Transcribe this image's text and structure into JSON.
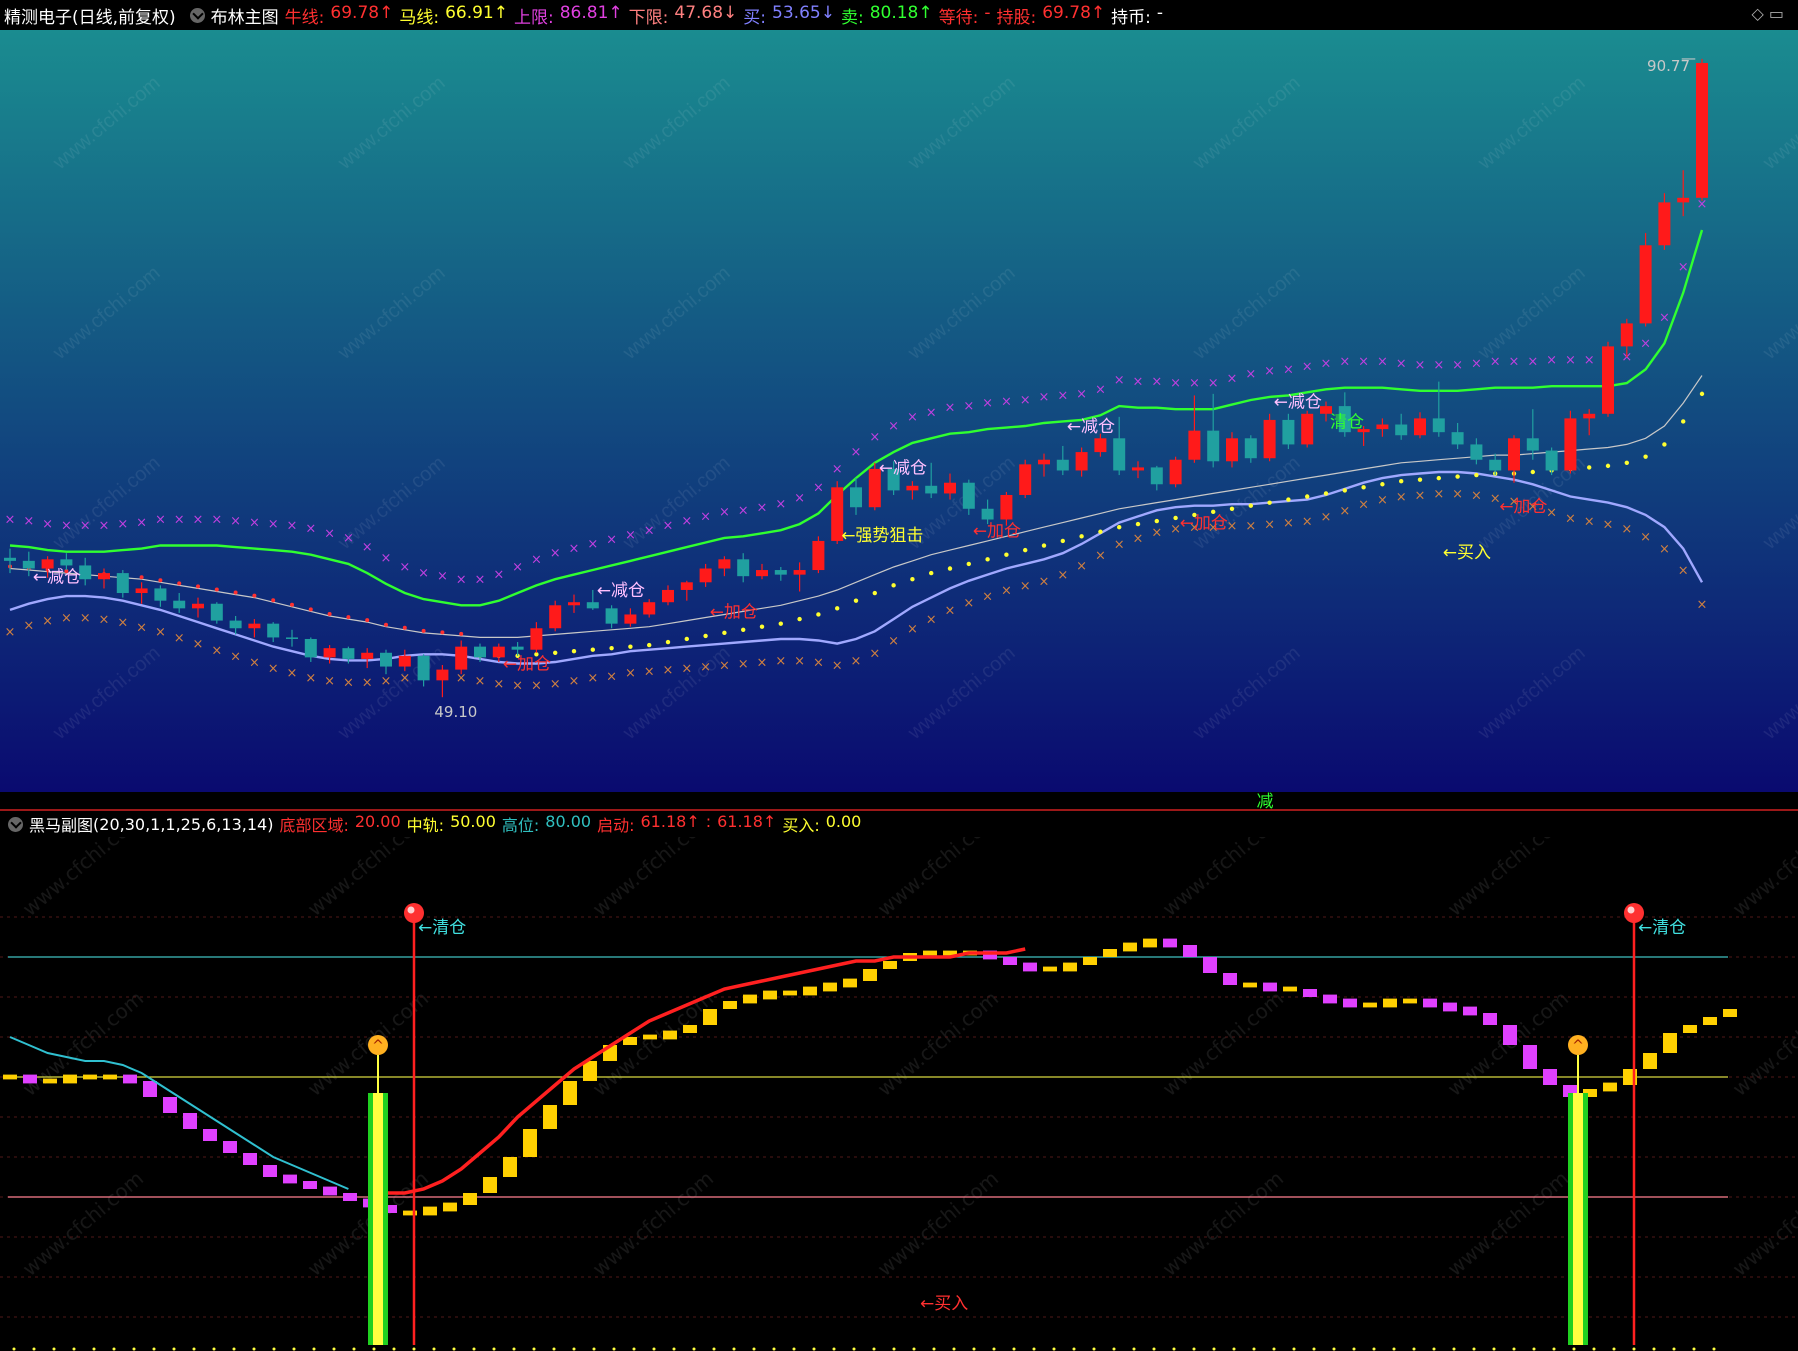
{
  "top_header": {
    "stock_name": "精测电子",
    "period": "(日线,前复权)",
    "indicator_name": "布林主图",
    "items": [
      {
        "label": "牛线:",
        "value": "69.78",
        "arrow": "↑",
        "color": "#ff3030"
      },
      {
        "label": "马线:",
        "value": "66.91",
        "arrow": "↑",
        "color": "#ffff30"
      },
      {
        "label": "上限:",
        "value": "86.81",
        "arrow": "↑",
        "color": "#e040e0"
      },
      {
        "label": "下限:",
        "value": "47.68",
        "arrow": "↓",
        "color": "#ff8080"
      },
      {
        "label": "买:",
        "value": "53.65",
        "arrow": "↓",
        "color": "#8080ff"
      },
      {
        "label": "卖:",
        "value": "80.18",
        "arrow": "↑",
        "color": "#30ff30"
      },
      {
        "label": "等待:",
        "value": "-",
        "arrow": "",
        "color": "#ff3030"
      },
      {
        "label": "持股:",
        "value": "69.78",
        "arrow": "↑",
        "color": "#ff3030"
      },
      {
        "label": "持币:",
        "value": "-",
        "arrow": "",
        "color": "#ffffff"
      }
    ],
    "right_icons": "◇ ▭"
  },
  "sub_header": {
    "indicator_name": "黑马副图",
    "params": "(20,30,1,1,25,6,13,14)",
    "items": [
      {
        "label": "底部区域:",
        "value": "20.00",
        "color": "#ff3030"
      },
      {
        "label": "中轨:",
        "value": "50.00",
        "color": "#ffff30"
      },
      {
        "label": "高位:",
        "value": "80.00",
        "color": "#30c0c0"
      },
      {
        "label": "启动:",
        "value": "61.18",
        "arrow": "↑",
        "color": "#ff3030"
      },
      {
        "label": ":",
        "value": "61.18",
        "arrow": "↑",
        "color": "#ff3030"
      },
      {
        "label": "买入:",
        "value": "0.00",
        "color": "#ffff30"
      }
    ]
  },
  "main_annotations": {
    "high_label": "90.77",
    "low_label": "49.10",
    "divider_mark": "减",
    "signals": [
      {
        "text": "←减仓",
        "color": "#ffc0ff"
      },
      {
        "text": "←加仓",
        "color": "#ff3030"
      },
      {
        "text": "←减仓",
        "color": "#ffc0ff"
      },
      {
        "text": "←加仓",
        "color": "#ff3030"
      },
      {
        "text": "←强势狙击",
        "color": "#ffff30"
      },
      {
        "text": "←减仓",
        "color": "#ffc0ff"
      },
      {
        "text": "←加仓",
        "color": "#ff3030"
      },
      {
        "text": "←减仓",
        "color": "#ffc0ff"
      },
      {
        "text": "←加仓",
        "color": "#ff3030"
      },
      {
        "text": "←减仓",
        "color": "#ffc0ff"
      },
      {
        "text": "清仓",
        "color": "#30ff30"
      },
      {
        "text": "←买入",
        "color": "#ffff30"
      },
      {
        "text": "←加仓",
        "color": "#ff3030"
      }
    ]
  },
  "sub_annotations": {
    "signals": [
      {
        "text": "←清仓",
        "color": "#40e0e0"
      },
      {
        "text": "←清仓",
        "color": "#40e0e0"
      },
      {
        "text": "←买入",
        "color": "#ff3030"
      }
    ]
  },
  "watermark": "www.cfchi.com",
  "chart_data": [
    {
      "type": "candlestick",
      "title": "布林主图",
      "ylim": [
        45,
        92
      ],
      "max_label": 90.77,
      "min_label": 49.1,
      "candles": [
        [
          58.2,
          58.8,
          57.2,
          58.0
        ],
        [
          58.0,
          58.6,
          57.0,
          57.5
        ],
        [
          57.5,
          58.3,
          56.9,
          58.1
        ],
        [
          58.1,
          58.5,
          57.4,
          57.7
        ],
        [
          57.7,
          58.2,
          56.4,
          56.8
        ],
        [
          56.8,
          57.5,
          56.2,
          57.2
        ],
        [
          57.2,
          57.4,
          55.6,
          55.9
        ],
        [
          55.9,
          56.6,
          55.2,
          56.2
        ],
        [
          56.2,
          56.4,
          55.0,
          55.4
        ],
        [
          55.4,
          55.9,
          54.6,
          54.9
        ],
        [
          54.9,
          55.6,
          54.3,
          55.2
        ],
        [
          55.2,
          55.3,
          53.9,
          54.1
        ],
        [
          54.1,
          54.4,
          53.2,
          53.6
        ],
        [
          53.6,
          54.2,
          53.0,
          53.9
        ],
        [
          53.9,
          54.0,
          52.7,
          53.0
        ],
        [
          53.0,
          53.5,
          52.4,
          52.9
        ],
        [
          52.9,
          53.0,
          51.4,
          51.7
        ],
        [
          51.7,
          52.5,
          51.3,
          52.3
        ],
        [
          52.3,
          52.4,
          51.3,
          51.6
        ],
        [
          51.6,
          52.3,
          51.0,
          52.0
        ],
        [
          52.0,
          52.2,
          50.6,
          51.1
        ],
        [
          51.1,
          52.2,
          50.8,
          51.8
        ],
        [
          51.8,
          51.9,
          49.8,
          50.2
        ],
        [
          50.2,
          51.2,
          49.1,
          50.9
        ],
        [
          50.9,
          52.8,
          50.6,
          52.4
        ],
        [
          52.4,
          52.6,
          51.4,
          51.7
        ],
        [
          51.7,
          52.6,
          51.4,
          52.4
        ],
        [
          52.4,
          52.7,
          51.8,
          52.2
        ],
        [
          52.2,
          54.0,
          52.0,
          53.6
        ],
        [
          53.6,
          55.4,
          53.4,
          55.1
        ],
        [
          55.1,
          55.8,
          54.6,
          55.3
        ],
        [
          55.3,
          56.1,
          54.8,
          54.9
        ],
        [
          54.9,
          55.1,
          53.6,
          53.9
        ],
        [
          53.9,
          54.9,
          53.7,
          54.5
        ],
        [
          54.5,
          55.5,
          54.3,
          55.3
        ],
        [
          55.3,
          56.4,
          55.1,
          56.1
        ],
        [
          56.1,
          56.7,
          55.4,
          56.6
        ],
        [
          56.6,
          57.8,
          56.3,
          57.5
        ],
        [
          57.5,
          58.3,
          57.0,
          58.1
        ],
        [
          58.1,
          58.5,
          56.6,
          57.0
        ],
        [
          57.0,
          57.8,
          56.8,
          57.4
        ],
        [
          57.4,
          57.6,
          56.7,
          57.1
        ],
        [
          57.1,
          57.9,
          56.0,
          57.4
        ],
        [
          57.4,
          59.6,
          57.2,
          59.3
        ],
        [
          59.3,
          63.2,
          59.1,
          62.8
        ],
        [
          62.8,
          63.4,
          61.0,
          61.5
        ],
        [
          61.5,
          64.4,
          61.3,
          64.0
        ],
        [
          64.0,
          64.5,
          62.3,
          62.6
        ],
        [
          62.6,
          63.2,
          62.0,
          62.9
        ],
        [
          62.9,
          64.4,
          62.1,
          62.4
        ],
        [
          62.4,
          63.7,
          62.0,
          63.1
        ],
        [
          63.1,
          63.3,
          61.0,
          61.4
        ],
        [
          61.4,
          62.0,
          60.4,
          60.7
        ],
        [
          60.7,
          62.5,
          60.3,
          62.3
        ],
        [
          62.3,
          64.6,
          62.1,
          64.3
        ],
        [
          64.3,
          65.0,
          63.5,
          64.6
        ],
        [
          64.6,
          65.5,
          63.6,
          63.9
        ],
        [
          63.9,
          65.4,
          63.5,
          65.1
        ],
        [
          65.1,
          66.3,
          64.8,
          66.0
        ],
        [
          66.0,
          67.4,
          63.6,
          63.9
        ],
        [
          63.9,
          64.5,
          63.4,
          64.1
        ],
        [
          64.1,
          64.2,
          62.6,
          63.0
        ],
        [
          63.0,
          64.8,
          62.8,
          64.6
        ],
        [
          64.6,
          68.8,
          64.4,
          66.5
        ],
        [
          66.5,
          68.9,
          64.1,
          64.5
        ],
        [
          64.5,
          66.4,
          64.1,
          66.0
        ],
        [
          66.0,
          66.2,
          64.4,
          64.7
        ],
        [
          64.7,
          67.6,
          64.5,
          67.2
        ],
        [
          67.2,
          67.6,
          65.3,
          65.6
        ],
        [
          65.6,
          67.8,
          65.4,
          67.6
        ],
        [
          67.6,
          68.4,
          67.1,
          68.1
        ],
        [
          68.1,
          69.0,
          66.1,
          66.4
        ],
        [
          66.4,
          66.8,
          65.5,
          66.6
        ],
        [
          66.6,
          67.3,
          66.1,
          66.9
        ],
        [
          66.9,
          67.6,
          65.9,
          66.2
        ],
        [
          66.2,
          67.7,
          66.0,
          67.3
        ],
        [
          67.3,
          69.7,
          66.1,
          66.4
        ],
        [
          66.4,
          67.0,
          65.3,
          65.6
        ],
        [
          65.6,
          66.0,
          64.3,
          64.6
        ],
        [
          64.6,
          65.0,
          63.6,
          63.9
        ],
        [
          63.9,
          66.2,
          63.1,
          66.0
        ],
        [
          66.0,
          67.9,
          64.6,
          65.2
        ],
        [
          65.2,
          65.4,
          63.6,
          63.9
        ],
        [
          63.9,
          67.8,
          63.7,
          67.3
        ],
        [
          67.3,
          67.9,
          66.2,
          67.6
        ],
        [
          67.6,
          72.3,
          67.4,
          72.0
        ],
        [
          72.0,
          73.8,
          71.3,
          73.5
        ],
        [
          73.5,
          79.4,
          73.3,
          78.6
        ],
        [
          78.6,
          82.0,
          78.3,
          81.4
        ],
        [
          81.4,
          83.5,
          80.5,
          81.7
        ],
        [
          81.7,
          90.77,
          81.5,
          90.5
        ]
      ],
      "series": [
        {
          "name": "上限",
          "color": "#30ff30",
          "values": [
            59.0,
            58.9,
            58.7,
            58.6,
            58.6,
            58.6,
            58.7,
            58.8,
            59.0,
            59.0,
            59.0,
            59.0,
            58.9,
            58.8,
            58.7,
            58.6,
            58.4,
            58.1,
            57.8,
            57.2,
            56.5,
            55.9,
            55.5,
            55.3,
            55.1,
            55.1,
            55.4,
            55.9,
            56.4,
            56.8,
            57.1,
            57.4,
            57.7,
            58.0,
            58.3,
            58.6,
            58.9,
            59.2,
            59.5,
            59.6,
            59.8,
            60.0,
            60.4,
            61.1,
            62.3,
            63.4,
            64.4,
            65.1,
            65.7,
            66.0,
            66.3,
            66.4,
            66.6,
            66.7,
            66.8,
            67.0,
            67.1,
            67.2,
            67.5,
            68.1,
            68.0,
            68.0,
            67.9,
            67.9,
            67.9,
            68.2,
            68.5,
            68.7,
            68.8,
            69.0,
            69.2,
            69.3,
            69.3,
            69.3,
            69.2,
            69.1,
            69.1,
            69.1,
            69.2,
            69.3,
            69.3,
            69.3,
            69.4,
            69.4,
            69.4,
            69.4,
            69.6,
            70.5,
            72.2,
            75.5,
            79.6
          ]
        },
        {
          "name": "中轨",
          "color": "#c8c8c8",
          "values": [
            57.5,
            57.4,
            57.3,
            57.2,
            57.1,
            57.0,
            56.9,
            56.8,
            56.6,
            56.4,
            56.2,
            56.0,
            55.8,
            55.6,
            55.3,
            55.0,
            54.7,
            54.4,
            54.2,
            54.0,
            53.7,
            53.5,
            53.3,
            53.2,
            53.1,
            53.0,
            53.0,
            53.0,
            53.1,
            53.2,
            53.3,
            53.4,
            53.5,
            53.6,
            53.7,
            53.9,
            54.1,
            54.3,
            54.5,
            54.7,
            54.9,
            55.1,
            55.4,
            55.7,
            56.1,
            56.6,
            57.1,
            57.6,
            58.0,
            58.4,
            58.7,
            59.0,
            59.3,
            59.6,
            59.9,
            60.2,
            60.5,
            60.8,
            61.1,
            61.4,
            61.6,
            61.8,
            62.0,
            62.2,
            62.4,
            62.6,
            62.8,
            63.0,
            63.2,
            63.4,
            63.6,
            63.8,
            64.0,
            64.2,
            64.4,
            64.5,
            64.6,
            64.7,
            64.8,
            64.9,
            64.9,
            65.0,
            65.1,
            65.2,
            65.3,
            65.4,
            65.6,
            66.0,
            66.8,
            68.3,
            70.1
          ]
        },
        {
          "name": "下限",
          "color": "#a0a8ff",
          "values": [
            54.8,
            55.2,
            55.5,
            55.7,
            55.7,
            55.6,
            55.4,
            55.1,
            54.8,
            54.4,
            54.0,
            53.6,
            53.2,
            52.8,
            52.4,
            52.1,
            51.8,
            51.6,
            51.5,
            51.5,
            51.6,
            51.8,
            51.9,
            51.9,
            51.8,
            51.6,
            51.4,
            51.3,
            51.3,
            51.4,
            51.6,
            51.8,
            51.9,
            52.1,
            52.2,
            52.3,
            52.4,
            52.5,
            52.6,
            52.7,
            52.8,
            52.9,
            52.9,
            52.8,
            52.6,
            52.9,
            53.4,
            54.2,
            55.0,
            55.6,
            56.2,
            56.7,
            57.1,
            57.5,
            57.8,
            58.1,
            58.5,
            59.1,
            59.8,
            60.5,
            60.9,
            61.3,
            61.5,
            61.6,
            61.6,
            61.7,
            61.7,
            61.8,
            61.9,
            62.0,
            62.3,
            62.7,
            63.1,
            63.4,
            63.6,
            63.7,
            63.8,
            63.8,
            63.7,
            63.5,
            63.3,
            63.0,
            62.6,
            62.2,
            62.0,
            61.8,
            61.5,
            61.0,
            60.2,
            58.8,
            56.6
          ]
        }
      ]
    },
    {
      "type": "bar",
      "title": "黑马副图",
      "ylim": [
        -15,
        100
      ],
      "reference_lines": {
        "底部区域": 20,
        "中轨": 50,
        "高位": 80
      },
      "bars": [
        50,
        49,
        49,
        50,
        50,
        50,
        49,
        45,
        41,
        37,
        34,
        31,
        28,
        25,
        24,
        22,
        21,
        19,
        18,
        16,
        16,
        17,
        18,
        21,
        25,
        30,
        37,
        43,
        49,
        54,
        58,
        60,
        60,
        61,
        63,
        67,
        69,
        70,
        71,
        71,
        72,
        73,
        74,
        77,
        79,
        81,
        81,
        81,
        81,
        80,
        78,
        77,
        77,
        78,
        80,
        82,
        83,
        84,
        83,
        80,
        76,
        73,
        73,
        72,
        72,
        70,
        69,
        68,
        68,
        69,
        69,
        68,
        67,
        66,
        63,
        58,
        52,
        48,
        45,
        47,
        48,
        52,
        56,
        61,
        63,
        65,
        67
      ],
      "series": [
        {
          "name": "启动",
          "color": "#ff2020",
          "values": [
            null,
            null,
            null,
            null,
            null,
            null,
            null,
            null,
            null,
            null,
            null,
            null,
            null,
            null,
            null,
            null,
            null,
            null,
            null,
            null,
            21,
            21,
            22,
            24,
            27,
            31,
            35,
            40,
            44,
            48,
            52,
            55,
            58,
            61,
            64,
            66,
            68,
            70,
            72,
            73,
            74,
            75,
            76,
            77,
            78,
            79,
            79,
            80,
            80,
            80,
            80,
            81,
            81,
            81,
            82
          ]
        },
        {
          "name": "",
          "color": "#30c0d0",
          "values": [
            60,
            58,
            56,
            55,
            54,
            54,
            53,
            51,
            48,
            45,
            42,
            39,
            36,
            33,
            30,
            28,
            26,
            24,
            22
          ]
        }
      ],
      "buy_markers": [
        18,
        78
      ],
      "sell_markers": [
        20,
        81
      ]
    }
  ]
}
